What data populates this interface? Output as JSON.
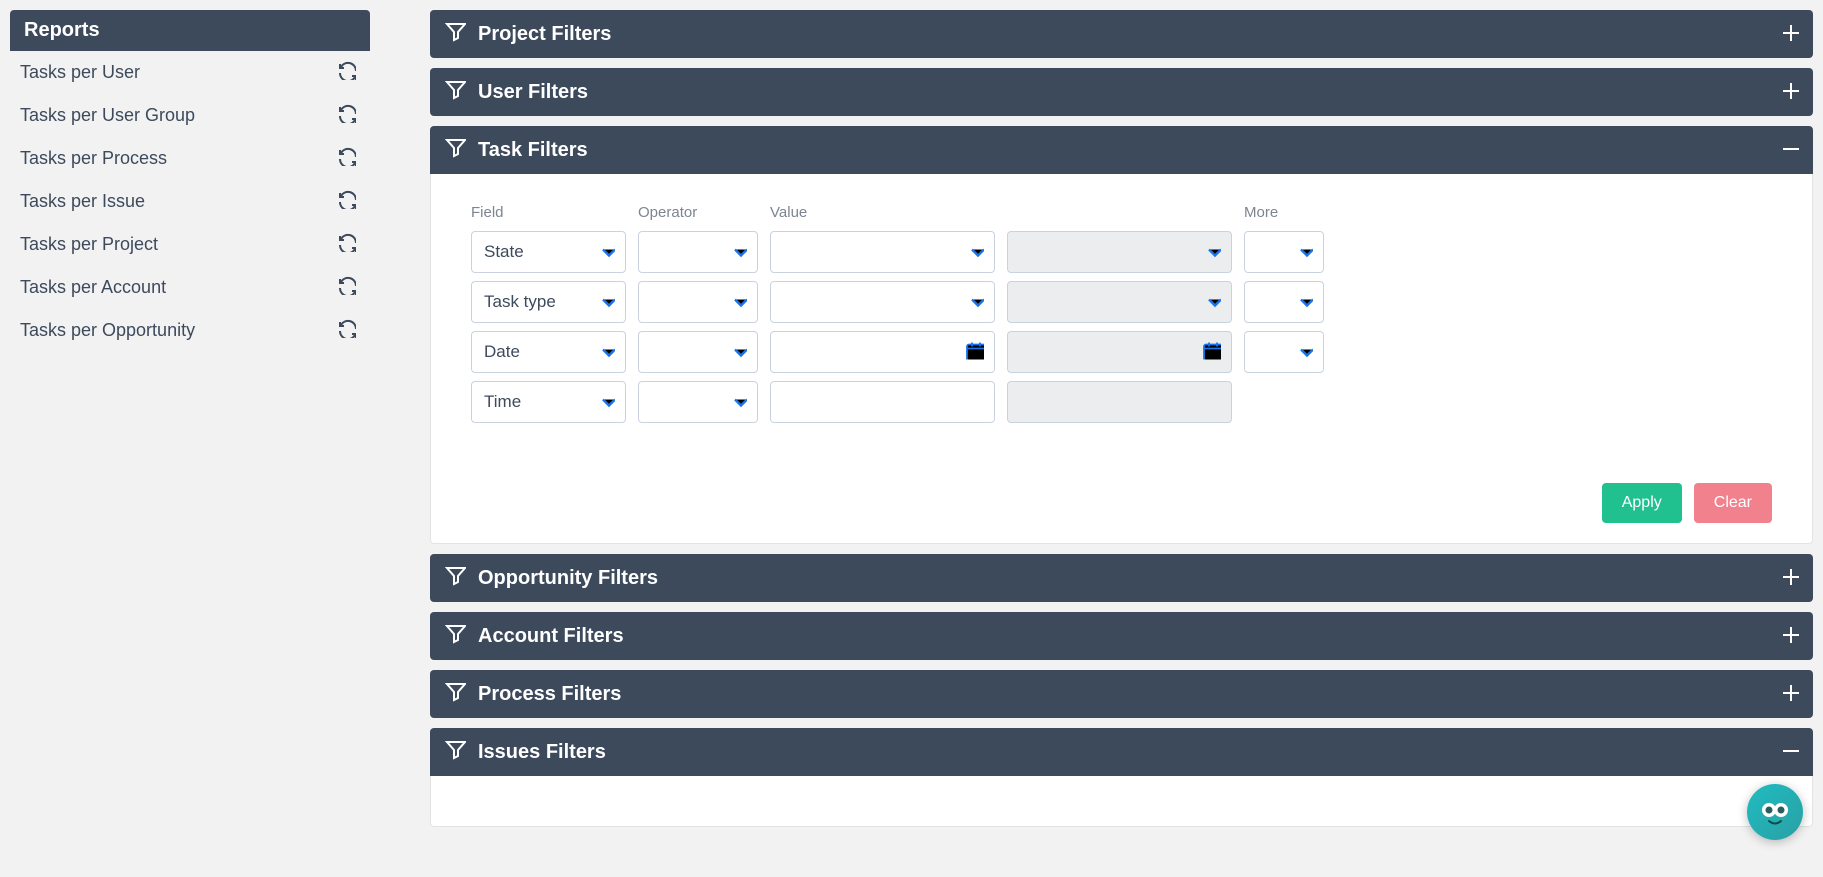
{
  "sidebar": {
    "title": "Reports",
    "items": [
      {
        "label": "Tasks per User"
      },
      {
        "label": "Tasks per User Group"
      },
      {
        "label": "Tasks per Process"
      },
      {
        "label": "Tasks per Issue"
      },
      {
        "label": "Tasks per Project"
      },
      {
        "label": "Tasks per Account"
      },
      {
        "label": "Tasks per Opportunity"
      }
    ]
  },
  "filter_panels": {
    "project": {
      "title": "Project Filters"
    },
    "user": {
      "title": "User Filters"
    },
    "task": {
      "title": "Task Filters"
    },
    "opportunity": {
      "title": "Opportunity Filters"
    },
    "account": {
      "title": "Account Filters"
    },
    "process": {
      "title": "Process Filters"
    },
    "issues": {
      "title": "Issues Filters"
    }
  },
  "task_filters": {
    "headers": {
      "field": "Field",
      "operator": "Operator",
      "value": "Value",
      "more": "More"
    },
    "rows": [
      {
        "field": "State",
        "value_kind": "select",
        "value2_kind": "select_disabled",
        "has_more": true
      },
      {
        "field": "Task type",
        "value_kind": "select",
        "value2_kind": "select_disabled",
        "has_more": true
      },
      {
        "field": "Date",
        "value_kind": "date",
        "value2_kind": "date_disabled",
        "has_more": true
      },
      {
        "field": "Time",
        "value_kind": "text",
        "value2_kind": "text_disabled",
        "has_more": false
      }
    ],
    "buttons": {
      "apply": "Apply",
      "clear": "Clear"
    }
  }
}
